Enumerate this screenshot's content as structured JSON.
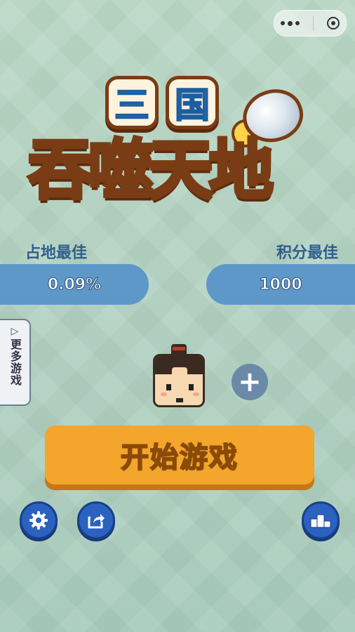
{
  "title": {
    "line1": [
      "三",
      "国"
    ],
    "line2": [
      "吞",
      "噬",
      "天",
      "地"
    ]
  },
  "stats": {
    "territory": {
      "label": "占地最佳",
      "value": "0.09%"
    },
    "score": {
      "label": "积分最佳",
      "value": "1000"
    }
  },
  "side_tab": {
    "arrow": "▷",
    "label": "更多游戏"
  },
  "add_button": {
    "label": "+"
  },
  "start_button": {
    "label": "开始游戏"
  },
  "icons": {
    "menu": "dots-icon",
    "close": "close-ring-icon",
    "settings": "gear-icon",
    "share": "share-icon",
    "ranking": "podium-icon"
  },
  "colors": {
    "stat_bar": "#5e98c9",
    "start_button": "#f3a52c",
    "round_button": "#2b62c0"
  }
}
